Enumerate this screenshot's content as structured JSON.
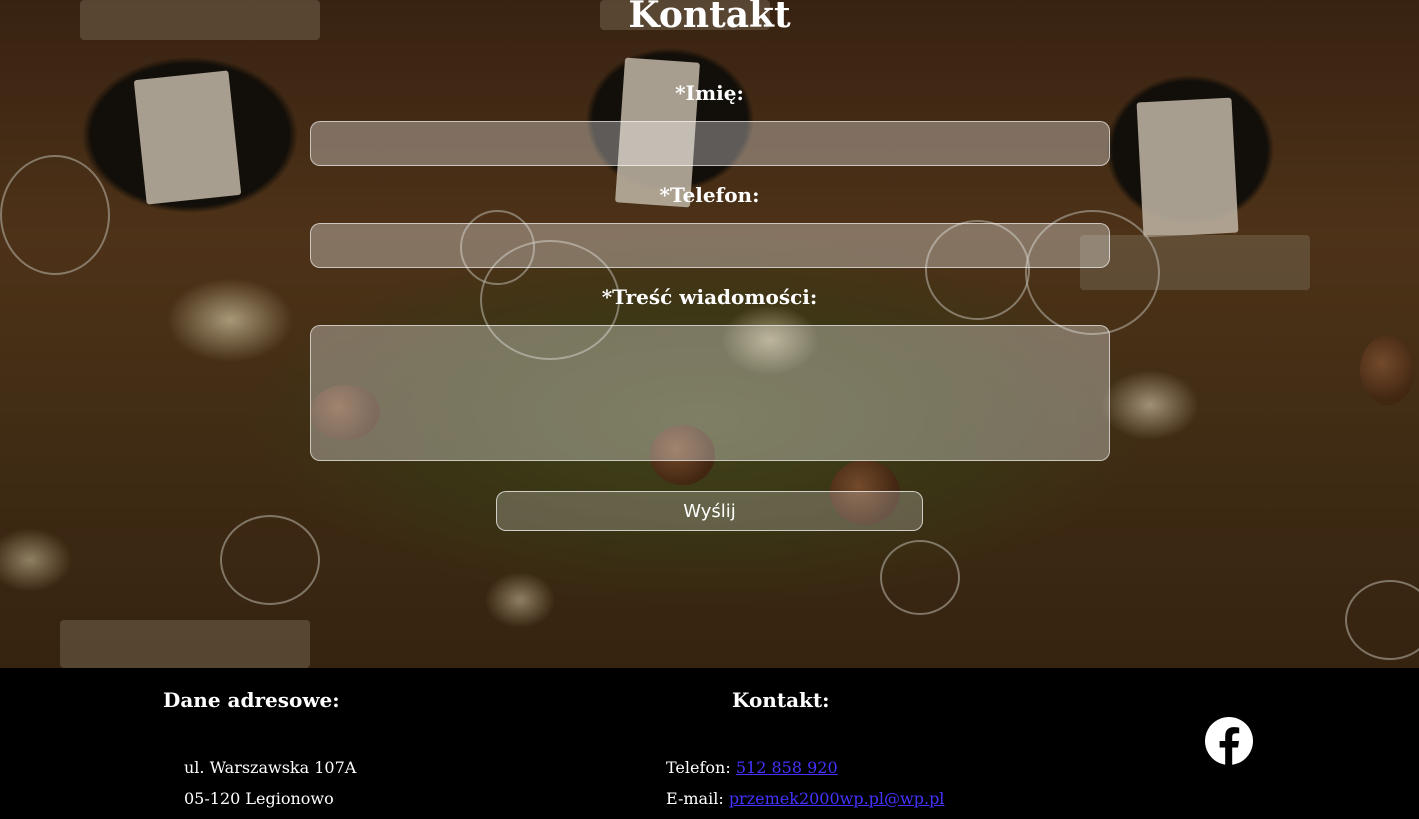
{
  "form": {
    "title": "Kontakt",
    "name_label": "*Imię:",
    "name_value": "",
    "phone_label": "*Telefon:",
    "phone_value": "",
    "message_label": "*Treść wiadomości:",
    "message_value": "",
    "submit_label": "Wyślij"
  },
  "footer": {
    "address_heading": "Dane adresowe:",
    "address_line1": "ul. Warszawska 107A",
    "address_line2": "05-120 Legionowo",
    "contact_heading": "Kontakt:",
    "phone_prefix": "Telefon:",
    "phone_value": "512 858 920",
    "email_prefix": "E-mail:",
    "email_value": "przemek2000wp.pl@wp.pl",
    "social_icon": "facebook-icon"
  },
  "colors": {
    "footer_bg": "#000000",
    "link": "#4433ff",
    "text": "#ffffff"
  }
}
